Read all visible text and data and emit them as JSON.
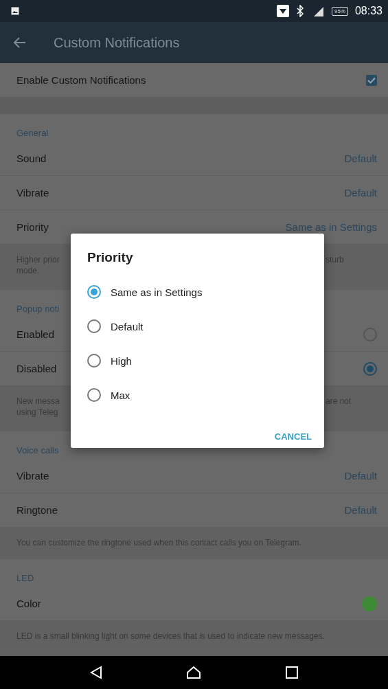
{
  "status_bar": {
    "battery": "95%",
    "time": "08:33"
  },
  "app_bar": {
    "title": "Custom Notifications"
  },
  "items": [
    {
      "kind": "toggle",
      "label": "Enable Custom Notifications",
      "checked": true
    },
    {
      "kind": "spacer"
    },
    {
      "kind": "header",
      "label": "General"
    },
    {
      "kind": "value",
      "label": "Sound",
      "value": "Default"
    },
    {
      "kind": "value",
      "label": "Vibrate",
      "value": "Default"
    },
    {
      "kind": "value",
      "label": "Priority",
      "value": "Same as in Settings"
    },
    {
      "kind": "split_info",
      "left_lines": [
        "Higher prior",
        "mode."
      ],
      "right_lines": [
        "sturb"
      ]
    },
    {
      "kind": "header",
      "label": "Popup noti"
    },
    {
      "kind": "radio",
      "label": "Enabled",
      "selected": false
    },
    {
      "kind": "radio",
      "label": "Disabled",
      "selected": true
    },
    {
      "kind": "split_info",
      "left_lines": [
        "New messa",
        "using Teleg"
      ],
      "right_lines": [
        "are not"
      ]
    },
    {
      "kind": "header",
      "label": "Voice calls"
    },
    {
      "kind": "value",
      "label": "Vibrate",
      "value": "Default"
    },
    {
      "kind": "value",
      "label": "Ringtone",
      "value": "Default"
    },
    {
      "kind": "info",
      "text": "You can customize the ringtone used when this contact calls you on Telegram."
    },
    {
      "kind": "header",
      "label": "LED"
    },
    {
      "kind": "color",
      "label": "Color",
      "color": "#3f8a35"
    },
    {
      "kind": "info",
      "text": "LED is a small blinking light on some devices that is used to indicate new messages."
    }
  ],
  "dialog": {
    "title": "Priority",
    "options": [
      {
        "label": "Same as in Settings",
        "selected": true
      },
      {
        "label": "Default",
        "selected": false
      },
      {
        "label": "High",
        "selected": false
      },
      {
        "label": "Max",
        "selected": false
      }
    ],
    "button": "CANCEL"
  }
}
